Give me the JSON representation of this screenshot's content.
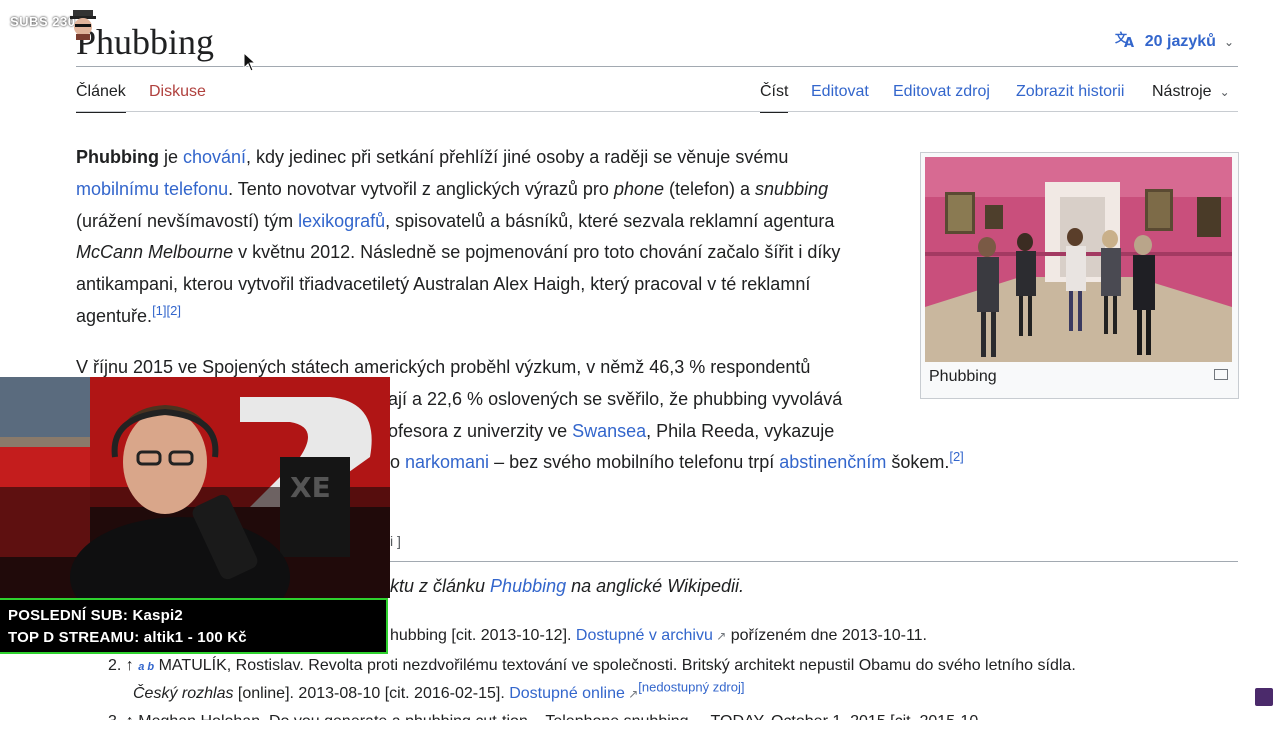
{
  "overlay": {
    "subs_counter": "SUBS 230",
    "banner_line1": "POSLEDNÍ SUB: Kaspi2",
    "banner_line2": "TOP D STREAMU: altik1 - 100 Kč"
  },
  "page": {
    "title": "Phubbing",
    "languages": "20 jazyků",
    "tabs": {
      "article": "Článek",
      "talk": "Diskuse",
      "read": "Číst",
      "edit": "Editovat",
      "edit_source": "Editovat zdroj",
      "history": "Zobrazit historii",
      "tools": "Nástroje"
    }
  },
  "content": {
    "p1": {
      "bold": "Phubbing",
      "t1": " je ",
      "l1": "chování",
      "t2": ", kdy jedinec při setkání přehlíží jiné osoby a raději se věnuje svému ",
      "l2": "mobilnímu telefonu",
      "t3": ". Tento novotvar vytvořil z anglických výrazů pro ",
      "i1": "phone",
      "t4": " (telefon) a ",
      "i2": "snubbing",
      "t5": " (urážení nevšímavostí) tým ",
      "l3": "lexikografů",
      "t6": ", spisovatelů a básníků, které sezvala reklamní agentura ",
      "i3": "McCann Melbourne",
      "t7": " v květnu 2012. Následně se pojmenování pro toto chování začalo šířit i díky antikampani, kterou vytvořil třiadvacetiletý Australan Alex Haigh, který pracoval v té reklamní agentuře.",
      "refs": "[1][2]"
    },
    "p2": {
      "t1": "V říjnu 2015 ve Spojených státech amerických proběhl výzkum, v němž 46,3 % respondentů",
      "t2": "ají a 22,6 % oslovených se svěřilo, že phubbing vyvolává",
      "t3": "ofesora z univerzity ve ",
      "l1": "Swansea",
      "t4": ", Phila Reeda, vykazuje",
      "t5": "ko ",
      "l2": "narkomani",
      "t6": " – bez svého mobilního telefonu trpí ",
      "l3": "abstinenčním",
      "t7": " šokem.",
      "ref": "[2]"
    },
    "figure_caption": "Phubbing",
    "edit_tail": "i ]",
    "source_note_1": "ktu z článku ",
    "source_note_link": "Phubbing",
    "source_note_2": " na anglické Wikipedii.",
    "ref1": {
      "t1": "hubbing [cit. 2013-10-12]. ",
      "link": "Dostupné v archivu",
      "t2": " pořízeném dne 2013-10-11."
    },
    "ref2": {
      "num": "2. ↑",
      "ab": "a b",
      "t1": " MATULÍK, Rostislav. Revolta proti nezdvořilému textování ve společnosti. Britský architekt nepustil Obamu do svého letního sídla.",
      "t2i": "Český rozhlas",
      "t2": " [online]. 2013-08-10 [cit. 2016-02-15]. ",
      "link": "Dostupné online",
      "dead": "[nedostupný zdroj]"
    },
    "ref3": "3. ↑ Meghan Holohan. Do you generate a phubbing cut-tion – Telephone snubbing ... TODAY. October 1, 2015 [cit. 2015-10"
  }
}
